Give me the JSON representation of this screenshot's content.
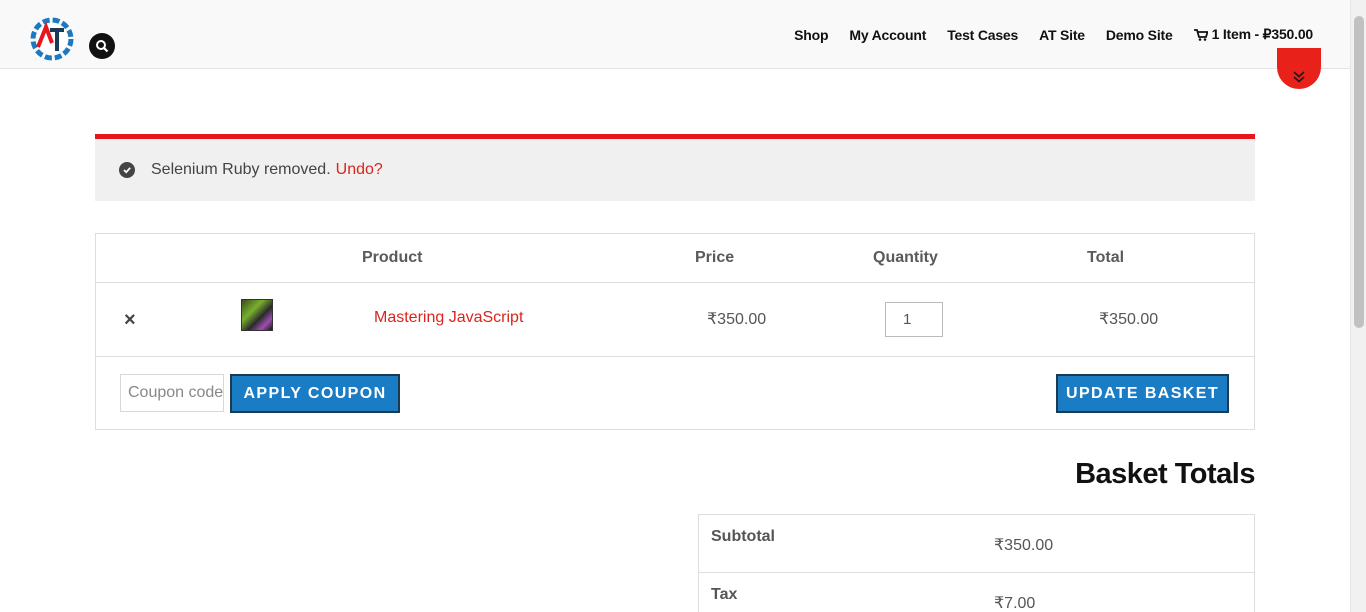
{
  "header": {
    "nav": [
      "Shop",
      "My Account",
      "Test Cases",
      "AT Site",
      "Demo Site"
    ],
    "cart_label": "1 Item - ₽350.00"
  },
  "notice": {
    "message": "Selenium Ruby removed.",
    "undo": "Undo?"
  },
  "cart": {
    "columns": {
      "product": "Product",
      "price": "Price",
      "quantity": "Quantity",
      "total": "Total"
    },
    "items": [
      {
        "remove": "×",
        "name": "Mastering JavaScript",
        "price": "₹350.00",
        "quantity": "1",
        "total": "₹350.00"
      }
    ],
    "coupon_placeholder": "Coupon code",
    "apply_coupon": "APPLY COUPON",
    "update_basket": "UPDATE BASKET"
  },
  "totals": {
    "title": "Basket Totals",
    "rows": [
      {
        "label": "Subtotal",
        "value": "₹350.00"
      },
      {
        "label": "Tax",
        "value": "₹7.00"
      }
    ]
  },
  "colors": {
    "accent": "#e6161c",
    "button": "#1a7cc4",
    "link": "#d9251e"
  },
  "icons": [
    "logo-icon",
    "search-icon",
    "cart-icon",
    "chevron-double-down-icon",
    "check-circle-icon",
    "remove-icon"
  ]
}
